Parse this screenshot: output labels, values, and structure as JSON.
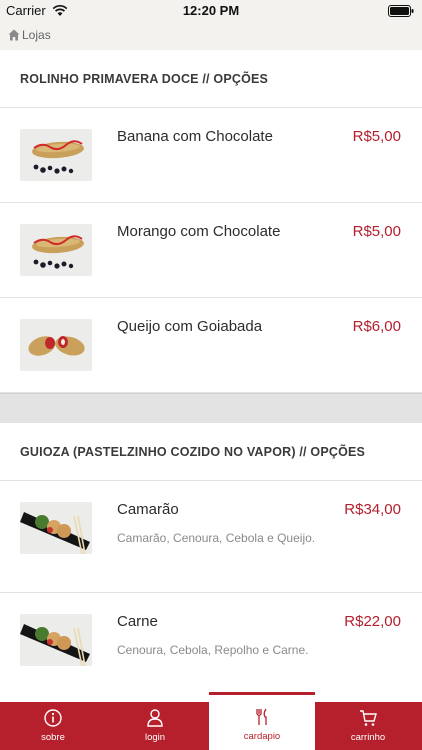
{
  "status_bar": {
    "carrier": "Carrier",
    "time": "12:20 PM"
  },
  "nav": {
    "back_label": "Lojas"
  },
  "sections": [
    {
      "title": "ROLINHO PRIMAVERA DOCE // OPÇÕES",
      "items": [
        {
          "name": "Banana com Chocolate",
          "price": "R$5,00",
          "thumb_icon": "spring-roll-photo"
        },
        {
          "name": "Morango com Chocolate",
          "price": "R$5,00",
          "thumb_icon": "spring-roll-photo"
        },
        {
          "name": "Queijo com Goiabada",
          "price": "R$6,00",
          "thumb_icon": "spring-roll-cut-photo"
        }
      ]
    },
    {
      "title": "GUIOZA (PASTELZINHO COZIDO NO VAPOR) // OPÇÕES",
      "items": [
        {
          "name": "Camarão",
          "price": "R$34,00",
          "description": "Camarão, Cenoura, Cebola e Queijo.",
          "thumb_icon": "gyoza-plate-photo"
        },
        {
          "name": "Carne",
          "price": "R$22,00",
          "description": "Cenoura, Cebola, Repolho e Carne.",
          "thumb_icon": "gyoza-plate-photo"
        }
      ]
    }
  ],
  "tabs": [
    {
      "label": "sobre",
      "icon": "info-icon"
    },
    {
      "label": "login",
      "icon": "user-icon"
    },
    {
      "label": "cardapio",
      "icon": "cutlery-icon",
      "active": true
    },
    {
      "label": "carrinho",
      "icon": "cart-icon"
    }
  ],
  "colors": {
    "brand": "#b6202c",
    "price": "#b3202f",
    "bar_bg": "#f3f2ef"
  }
}
